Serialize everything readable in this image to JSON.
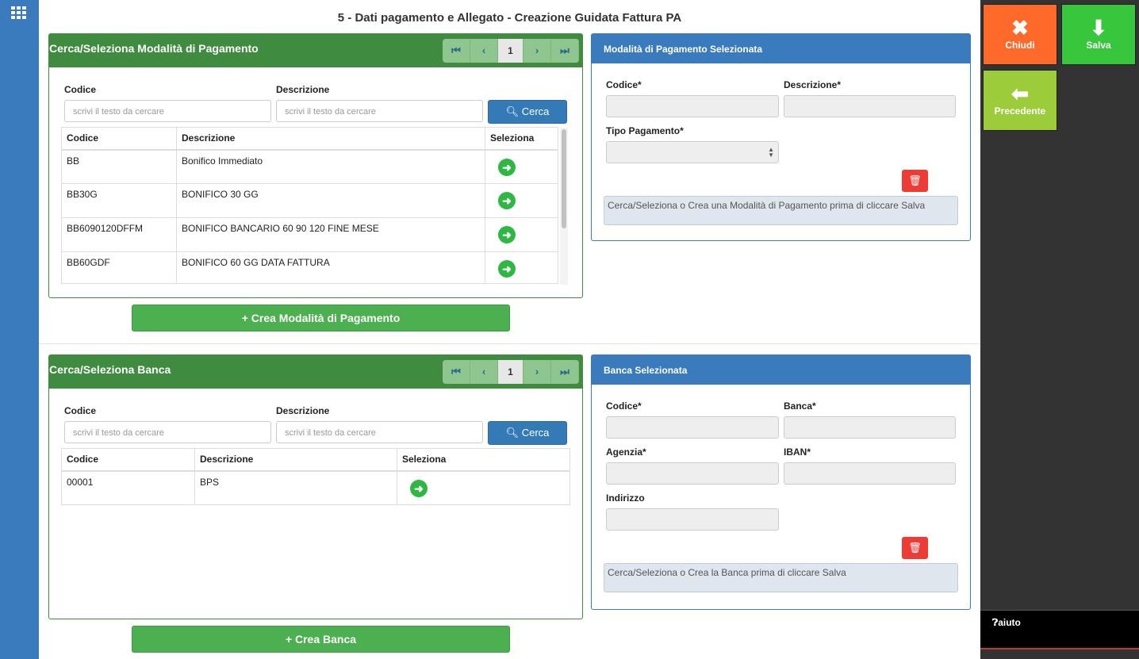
{
  "app": {
    "grid_icon": "apps-grid-icon"
  },
  "page_title": "5 - Dati pagamento e Allegato - Creazione Guidata Fattura PA",
  "pagamento_search": {
    "title": "Cerca/Seleziona Modalità di Pagamento",
    "pager": {
      "first": "⏮",
      "prev": "‹",
      "page": "1",
      "next": "›",
      "last": "⏭"
    },
    "codice_label": "Codice",
    "descrizione_label": "Descrizione",
    "codice_placeholder": "scrivi il testo da cercare",
    "descrizione_placeholder": "scrivi il testo da cercare",
    "cerca_label": "Cerca",
    "columns": [
      "Codice",
      "Descrizione",
      "Seleziona"
    ],
    "rows": [
      {
        "codice": "BB",
        "descrizione": "Bonifico Immediato"
      },
      {
        "codice": "BB30G",
        "descrizione": "BONIFICO 30 GG"
      },
      {
        "codice": "BB6090120DFFM",
        "descrizione": "BONIFICO BANCARIO 60 90 120 FINE MESE"
      },
      {
        "codice": "BB60GDF",
        "descrizione": "BONIFICO 60 GG DATA FATTURA"
      }
    ],
    "crea_label": "+ Crea Modalità di Pagamento"
  },
  "pagamento_selected": {
    "title": "Modalità di Pagamento Selezionata",
    "codice_label": "Codice*",
    "descrizione_label": "Descrizione*",
    "tipo_label": "Tipo Pagamento*",
    "note": "Cerca/Seleziona o Crea una Modalità di Pagamento prima di cliccare Salva"
  },
  "banca_search": {
    "title": "Cerca/Seleziona Banca",
    "pager": {
      "first": "⏮",
      "prev": "‹",
      "page": "1",
      "next": "›",
      "last": "⏭"
    },
    "codice_label": "Codice",
    "descrizione_label": "Descrizione",
    "codice_placeholder": "scrivi il testo da cercare",
    "descrizione_placeholder": "scrivi il testo da cercare",
    "cerca_label": "Cerca",
    "columns": [
      "Codice",
      "Descrizione",
      "Seleziona"
    ],
    "rows": [
      {
        "codice": "00001",
        "descrizione": "BPS"
      }
    ],
    "crea_label": "+ Crea Banca"
  },
  "banca_selected": {
    "title": "Banca Selezionata",
    "codice_label": "Codice*",
    "banca_label": "Banca*",
    "agenzia_label": "Agenzia*",
    "iban_label": "IBAN*",
    "indirizzo_label": "Indirizzo",
    "note": "Cerca/Seleziona o Crea la Banca prima di cliccare Salva"
  },
  "actions": {
    "chiudi": "Chiudi",
    "salva": "Salva",
    "precedente": "Precedente",
    "aiuto": "aiuto"
  },
  "colors": {
    "sidebar": "#3a7bbd",
    "green_header": "#3f8b3f",
    "chiudi": "#ff6a2b",
    "salva": "#37c63c",
    "precedente": "#9ccc3a"
  }
}
